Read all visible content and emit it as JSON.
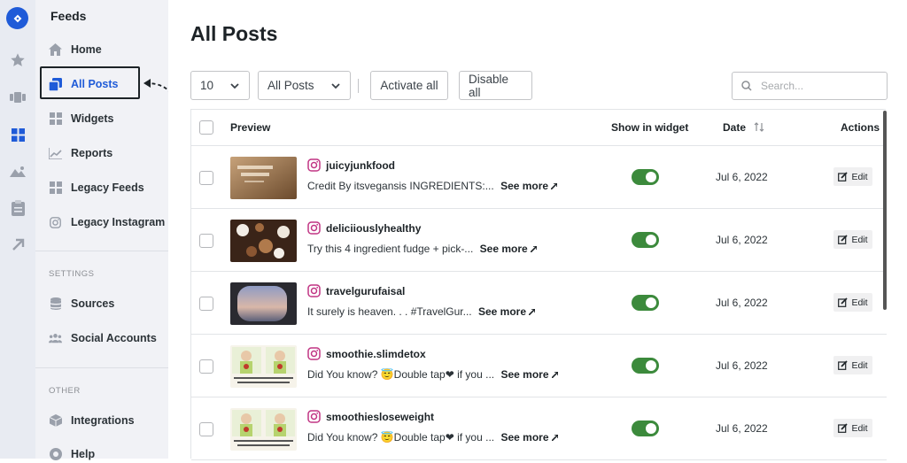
{
  "sidebar": {
    "title": "Feeds",
    "items": [
      {
        "label": "Home"
      },
      {
        "label": "All Posts"
      },
      {
        "label": "Widgets"
      },
      {
        "label": "Reports"
      },
      {
        "label": "Legacy Feeds"
      },
      {
        "label": "Legacy Instagram"
      }
    ],
    "settings_label": "SETTINGS",
    "settings_items": [
      {
        "label": "Sources"
      },
      {
        "label": "Social Accounts"
      }
    ],
    "other_label": "OTHER",
    "other_items": [
      {
        "label": "Integrations"
      },
      {
        "label": "Help"
      }
    ]
  },
  "main": {
    "title": "All Posts",
    "toolbar": {
      "per_page": "10",
      "filter": "All Posts",
      "activate_all": "Activate all",
      "disable_all": "Disable all",
      "search_placeholder": "Search..."
    },
    "table": {
      "headers": {
        "preview": "Preview",
        "show_in_widget": "Show in widget",
        "date": "Date",
        "actions": "Actions"
      },
      "edit_label": "Edit",
      "see_more_label": "See more",
      "rows": [
        {
          "username": "juicyjunkfood",
          "caption": "Credit By itsvegansis INGREDIENTS:...",
          "date": "Jul 6, 2022",
          "shown": true
        },
        {
          "username": "deliciiouslyhealthy",
          "caption": "Try this 4 ingredient fudge + pick-...",
          "date": "Jul 6, 2022",
          "shown": true
        },
        {
          "username": "travelgurufaisal",
          "caption": "It surely is heaven. . . #TravelGur...",
          "date": "Jul 6, 2022",
          "shown": true
        },
        {
          "username": "smoothie.slimdetox",
          "caption": "Did You know? 😇Double tap❤ if you ...",
          "date": "Jul 6, 2022",
          "shown": true
        },
        {
          "username": "smoothiesloseweight",
          "caption": "Did You know? 😇Double tap❤ if you ...",
          "date": "Jul 6, 2022",
          "shown": true
        }
      ]
    }
  },
  "colors": {
    "accent": "#1f5bd8",
    "toggle_on": "#3c8a3c",
    "instagram": "#c13584"
  }
}
